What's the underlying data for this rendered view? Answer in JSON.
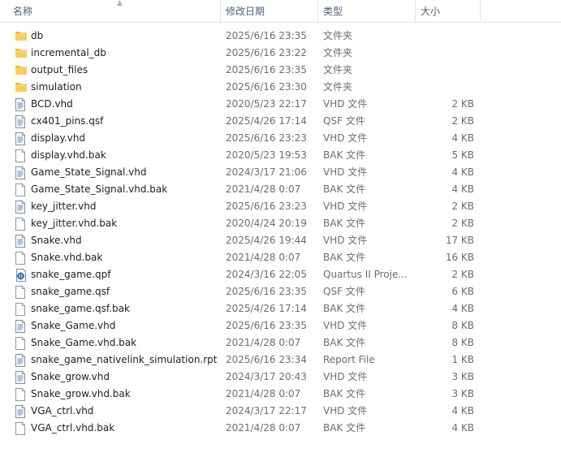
{
  "columns": {
    "name": "名称",
    "modified": "修改日期",
    "type": "类型",
    "size": "大小"
  },
  "files": [
    {
      "name": "db",
      "modified": "2025/6/16 23:35",
      "type": "文件夹",
      "size": "",
      "icon": "folder-icon"
    },
    {
      "name": "incremental_db",
      "modified": "2025/6/16 23:22",
      "type": "文件夹",
      "size": "",
      "icon": "folder-icon"
    },
    {
      "name": "output_files",
      "modified": "2025/6/16 23:35",
      "type": "文件夹",
      "size": "",
      "icon": "folder-icon"
    },
    {
      "name": "simulation",
      "modified": "2025/6/16 23:30",
      "type": "文件夹",
      "size": "",
      "icon": "folder-icon"
    },
    {
      "name": "BCD.vhd",
      "modified": "2020/5/23 22:17",
      "type": "VHD 文件",
      "size": "2 KB",
      "icon": "text-file-icon"
    },
    {
      "name": "cx401_pins.qsf",
      "modified": "2025/4/26 17:14",
      "type": "QSF 文件",
      "size": "2 KB",
      "icon": "text-file-icon"
    },
    {
      "name": "display.vhd",
      "modified": "2025/6/16 23:23",
      "type": "VHD 文件",
      "size": "4 KB",
      "icon": "text-file-icon"
    },
    {
      "name": "display.vhd.bak",
      "modified": "2020/5/23 19:53",
      "type": "BAK 文件",
      "size": "5 KB",
      "icon": "blank-file-icon"
    },
    {
      "name": "Game_State_Signal.vhd",
      "modified": "2024/3/17 21:06",
      "type": "VHD 文件",
      "size": "4 KB",
      "icon": "text-file-icon"
    },
    {
      "name": "Game_State_Signal.vhd.bak",
      "modified": "2021/4/28 0:07",
      "type": "BAK 文件",
      "size": "4 KB",
      "icon": "blank-file-icon"
    },
    {
      "name": "key_jitter.vhd",
      "modified": "2025/6/16 23:23",
      "type": "VHD 文件",
      "size": "2 KB",
      "icon": "text-file-icon"
    },
    {
      "name": "key_jitter.vhd.bak",
      "modified": "2020/4/24 20:19",
      "type": "BAK 文件",
      "size": "2 KB",
      "icon": "blank-file-icon"
    },
    {
      "name": "Snake.vhd",
      "modified": "2025/4/26 19:44",
      "type": "VHD 文件",
      "size": "17 KB",
      "icon": "text-file-icon"
    },
    {
      "name": "Snake.vhd.bak",
      "modified": "2021/4/28 0:07",
      "type": "BAK 文件",
      "size": "16 KB",
      "icon": "blank-file-icon"
    },
    {
      "name": "snake_game.qpf",
      "modified": "2024/3/16 22:05",
      "type": "Quartus II Proje...",
      "size": "2 KB",
      "icon": "quartus-project-icon"
    },
    {
      "name": "snake_game.qsf",
      "modified": "2025/6/16 23:35",
      "type": "QSF 文件",
      "size": "6 KB",
      "icon": "blank-file-icon"
    },
    {
      "name": "snake_game.qsf.bak",
      "modified": "2025/4/26 17:14",
      "type": "BAK 文件",
      "size": "4 KB",
      "icon": "blank-file-icon"
    },
    {
      "name": "Snake_Game.vhd",
      "modified": "2025/6/16 23:35",
      "type": "VHD 文件",
      "size": "8 KB",
      "icon": "text-file-icon"
    },
    {
      "name": "Snake_Game.vhd.bak",
      "modified": "2021/4/28 0:07",
      "type": "BAK 文件",
      "size": "8 KB",
      "icon": "blank-file-icon"
    },
    {
      "name": "snake_game_nativelink_simulation.rpt",
      "modified": "2025/6/16 23:34",
      "type": "Report File",
      "size": "1 KB",
      "icon": "text-file-icon"
    },
    {
      "name": "Snake_grow.vhd",
      "modified": "2024/3/17 20:43",
      "type": "VHD 文件",
      "size": "3 KB",
      "icon": "text-file-icon"
    },
    {
      "name": "Snake_grow.vhd.bak",
      "modified": "2021/4/28 0:07",
      "type": "BAK 文件",
      "size": "3 KB",
      "icon": "blank-file-icon"
    },
    {
      "name": "VGA_ctrl.vhd",
      "modified": "2024/3/17 22:17",
      "type": "VHD 文件",
      "size": "4 KB",
      "icon": "text-file-icon"
    },
    {
      "name": "VGA_ctrl.vhd.bak",
      "modified": "2021/4/28 0:07",
      "type": "BAK 文件",
      "size": "4 KB",
      "icon": "blank-file-icon"
    }
  ]
}
